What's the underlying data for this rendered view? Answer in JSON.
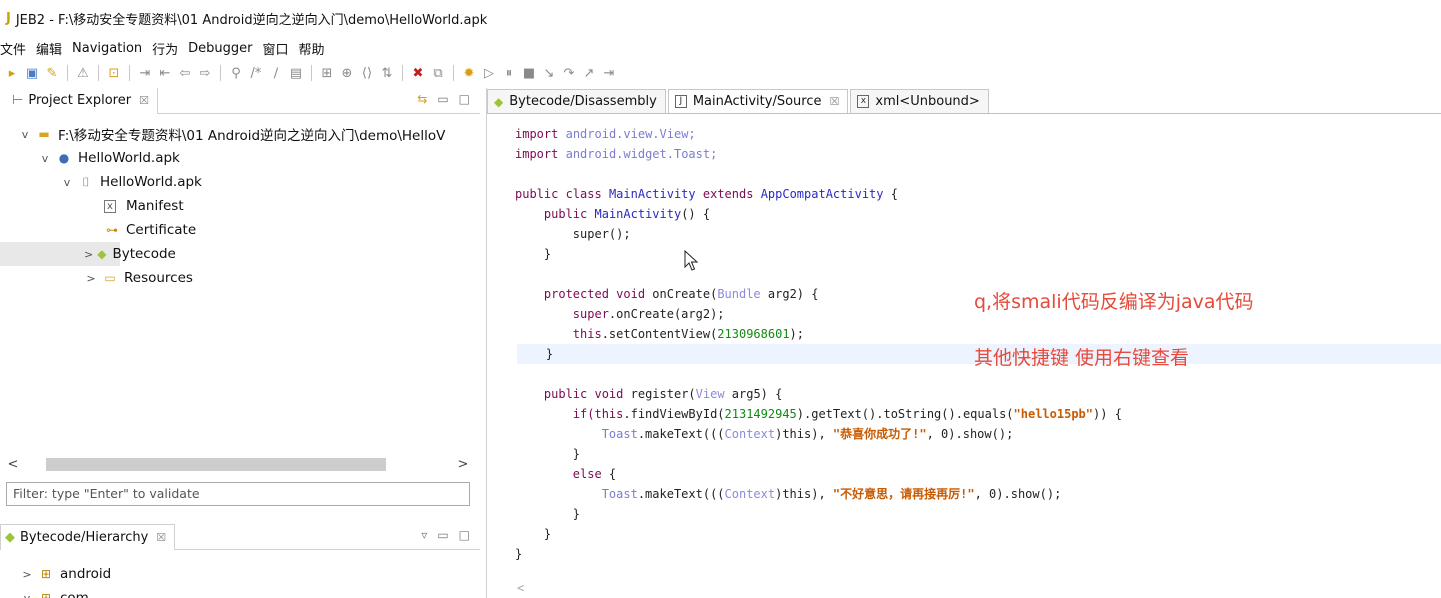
{
  "window": {
    "title": "JEB2 - F:\\移动安全专题资料\\01 Android逆向之逆向入门\\demo\\HelloWorld.apk"
  },
  "menu": [
    "文件",
    "编辑",
    "Navigation",
    "行为",
    "Debugger",
    "窗口",
    "帮助"
  ],
  "project_explorer": {
    "tab_label": "Project Explorer",
    "tree": [
      {
        "level": 0,
        "chev": "v",
        "icon": "folder-icon",
        "label": "F:\\移动安全专题资料\\01 Android逆向之逆向入门\\demo\\HelloV"
      },
      {
        "level": 1,
        "chev": "v",
        "icon": "dot-icon",
        "label": "HelloWorld.apk"
      },
      {
        "level": 2,
        "chev": "v",
        "icon": "apk-icon",
        "label": "HelloWorld.apk"
      },
      {
        "level": 3,
        "chev": "",
        "icon": "manifest-icon",
        "label": "Manifest"
      },
      {
        "level": 3,
        "chev": "",
        "icon": "certificate-icon",
        "label": "Certificate"
      },
      {
        "level": 3,
        "chev": ">",
        "icon": "android-icon",
        "label": "Bytecode"
      },
      {
        "level": 3,
        "chev": ">",
        "icon": "resources-folder-icon",
        "label": "Resources"
      }
    ],
    "filter_text": "Filter: type \"Enter\" to validate"
  },
  "hierarchy": {
    "tab_label": "Bytecode/Hierarchy",
    "tree": [
      {
        "chev": ">",
        "label": "android"
      },
      {
        "chev": "v",
        "label": "com"
      }
    ]
  },
  "editor": {
    "tabs": [
      {
        "label": "Bytecode/Disassembly",
        "icon": "android-icon",
        "active": false,
        "closable": false
      },
      {
        "label": "MainActivity/Source",
        "icon": "source-file-icon",
        "active": true,
        "closable": true
      },
      {
        "label": "xml<Unbound>",
        "icon": "xml-file-icon",
        "active": false,
        "closable": false
      }
    ],
    "code": {
      "import1_kw": "import",
      "import1_pkg": "android.view.View;",
      "import2_kw": "import",
      "import2_pkg": "android.widget.Toast;",
      "class_decl_kw": "public class",
      "class_name": "MainActivity",
      "extends_kw": "extends",
      "super_class": "AppCompatActivity",
      "brace_open": " {",
      "ctor_kw": "public",
      "ctor_name": "MainActivity",
      "ctor_rest": "() {",
      "super_call": "super();",
      "close_brace": "}",
      "oncreate_kw": "protected void",
      "oncreate_name": " onCreate(",
      "oncreate_type": "Bundle",
      "oncreate_rest": " arg2) {",
      "super_oncreate_kw": "super",
      "super_oncreate_rest": ".onCreate(arg2);",
      "setcontent_kw": "this",
      "setcontent_rest": ".setContentView(",
      "setcontent_num": "2130968601",
      "setcontent_end": ");",
      "register_kw": "public void",
      "register_name": " register(",
      "register_type": "View",
      "register_rest": " arg5) {",
      "if_kw": "if(this",
      "if_rest": ".findViewById(",
      "if_num": "2131492945",
      "if_rest2": ").getText().toString().equals(",
      "if_str": "\"hello15pb\"",
      "if_end": ")) {",
      "toast1_a": "Toast",
      "toast1_b": ".makeText(((",
      "toast1_type": "Context",
      "toast1_c": ")this), ",
      "toast1_str": "\"恭喜你成功了!\"",
      "toast1_d": ", 0).show();",
      "else_kw": "else",
      "else_rest": " {",
      "toast2_a": "Toast",
      "toast2_b": ".makeText(((",
      "toast2_type": "Context",
      "toast2_c": ")this), ",
      "toast2_str": "\"不好意思，请再接再厉!\"",
      "toast2_d": ", 0).show();",
      "last_marker": "<"
    }
  },
  "annotations": {
    "note1": "q,将smali代码反编译为java代码",
    "note2": "其他快捷键 使用右键查看",
    "color": "#e64a3a"
  }
}
